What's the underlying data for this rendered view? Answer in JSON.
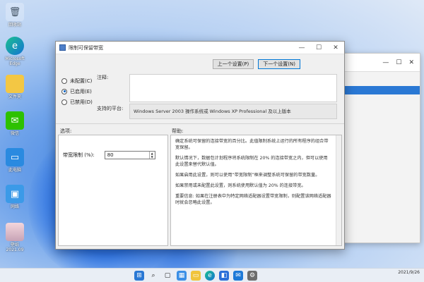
{
  "desktop": {
    "icons": [
      {
        "label": "回收站",
        "icon": "recycle-bin-icon"
      },
      {
        "label": "Microsoft Edge",
        "icon": "edge-icon"
      },
      {
        "label": "文件夹",
        "icon": "folder-icon"
      },
      {
        "label": "微信",
        "icon": "wechat-icon"
      },
      {
        "label": "此电脑",
        "icon": "computer-icon"
      },
      {
        "label": "网络",
        "icon": "network-icon"
      },
      {
        "label": "壁纸\n2021.09",
        "icon": "image-file-icon"
      }
    ]
  },
  "dialog": {
    "title": "限制可保留带宽",
    "prev_setting": "上一个设置(P)",
    "next_setting": "下一个设置(N)",
    "radios": [
      {
        "label": "未配置(C)",
        "checked": false
      },
      {
        "label": "已启用(E)",
        "checked": true
      },
      {
        "label": "已禁用(D)",
        "checked": false
      }
    ],
    "comment_label": "注释:",
    "platform_label": "支持的平台:",
    "platform_value": "Windows Server 2003 操作系统或 Windows XP Professional 及以上版本",
    "options_label": "选项:",
    "help_label": "帮助:",
    "bandwidth_label": "带宽限制 (%):",
    "bandwidth_value": "80",
    "help_paragraphs": [
      "确定系统可保留的连接带宽的百分比。此值限制系统上运行的所有程序的组合带宽保留。",
      "默认情况下，数据包计划程序将系统限制在 20% 的连接带宽之内，但可以使用此设置来替代默认值。",
      "如果启用此设置，则可以使用“带宽限制”框来调整系统可保留的带宽数量。",
      "如果禁用或未配置此设置，则系统使用默认值为 20% 的连接带宽。",
      "重要信息: 如果在注册表中为特定网络适配器设置带宽限制，则配置该网络适配器时就会忽略此设置。"
    ]
  },
  "taskbar": {
    "icons": [
      "windows-start-icon",
      "search-icon",
      "task-view-icon",
      "widgets-icon",
      "explorer-icon",
      "edge-icon",
      "store-icon",
      "mail-icon",
      "settings-icon"
    ],
    "date": "2021/9/26"
  },
  "colors": {
    "accent": "#0078d7",
    "selection": "#2a78d4"
  }
}
